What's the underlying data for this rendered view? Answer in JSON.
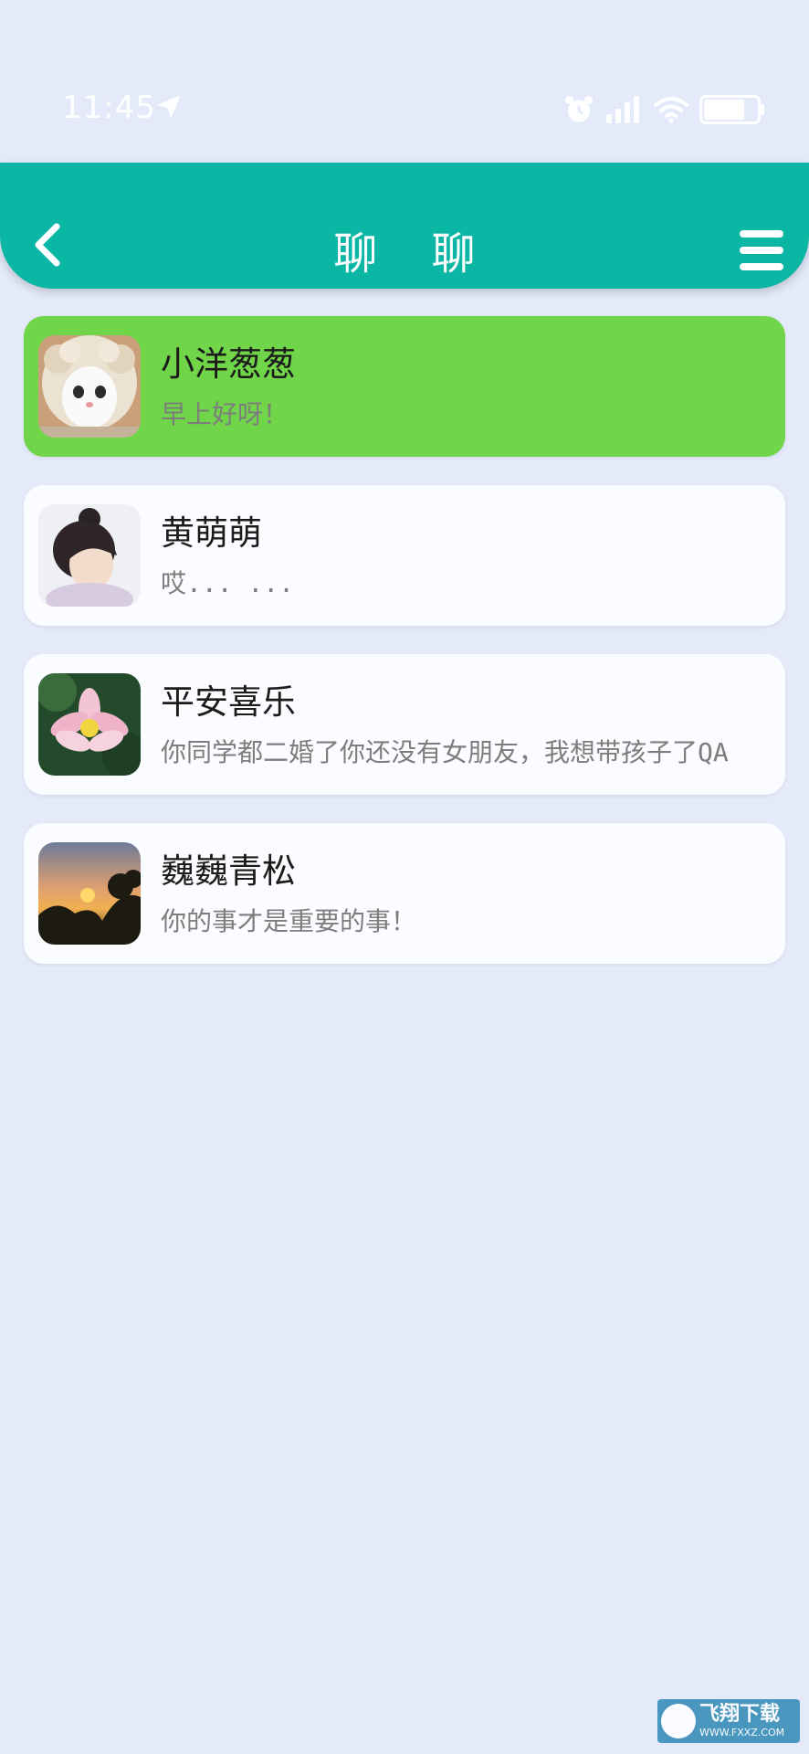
{
  "status_bar": {
    "time": "11:45",
    "battery_level": 0.75,
    "icons": [
      "location-arrow-icon",
      "alarm-clock-icon",
      "signal-icon",
      "wifi-icon",
      "battery-icon"
    ]
  },
  "header": {
    "title": "聊 聊",
    "back_icon": "chevron-left-icon",
    "menu_icon": "hamburger-menu-icon",
    "background": "#0cb6a4"
  },
  "chats": [
    {
      "name": "小洋葱葱",
      "message": "早上好呀！",
      "avatar": "cat-avatar",
      "active": true
    },
    {
      "name": "黄萌萌",
      "message": "哎... ...",
      "avatar": "girl-avatar",
      "active": false
    },
    {
      "name": "平安喜乐",
      "message": "你同学都二婚了你还没有女朋友，我想带孩子了QA",
      "avatar": "lotus-avatar",
      "active": false
    },
    {
      "name": "巍巍青松",
      "message": "你的事才是重要的事！",
      "avatar": "sunset-avatar",
      "active": false
    }
  ],
  "colors": {
    "background": "#e4eafa",
    "active_item": "#70d548",
    "item": "#fbfcff"
  },
  "watermark": {
    "main": "飞翔下载",
    "sub": "WWW.FXXZ.COM"
  }
}
